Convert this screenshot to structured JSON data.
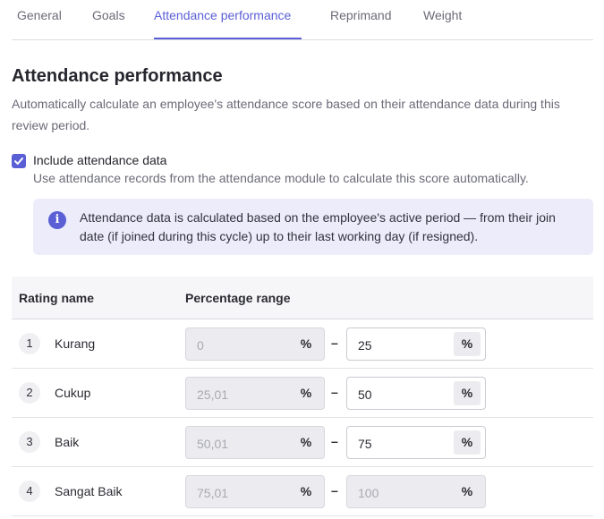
{
  "tabs": [
    {
      "label": "General",
      "active": false
    },
    {
      "label": "Goals",
      "active": false
    },
    {
      "label": "Attendance performance",
      "active": true
    },
    {
      "label": "Reprimand",
      "active": false
    },
    {
      "label": "Weight",
      "active": false
    }
  ],
  "section": {
    "title": "Attendance performance",
    "description": "Automatically calculate an employee's attendance score based on their attendance data during this review period."
  },
  "include_attendance": {
    "checked": true,
    "label": "Include attendance data",
    "help": "Use attendance records from the attendance module to calculate this score automatically."
  },
  "info": {
    "icon": "info-icon",
    "text": "Attendance data is calculated based on the employee's active period — from their join date (if joined during this cycle) up to their last working day (if resigned)."
  },
  "table": {
    "headers": {
      "rating_name": "Rating name",
      "percentage_range": "Percentage range"
    },
    "range_separator": "–",
    "unit": "%",
    "rows": [
      {
        "index": "1",
        "name": "Kurang",
        "from": "0",
        "to": "25",
        "to_editable": true
      },
      {
        "index": "2",
        "name": "Cukup",
        "from": "25,01",
        "to": "50",
        "to_editable": true
      },
      {
        "index": "3",
        "name": "Baik",
        "from": "50,01",
        "to": "75",
        "to_editable": true
      },
      {
        "index": "4",
        "name": "Sangat Baik",
        "from": "75,01",
        "to": "100",
        "to_editable": false
      }
    ]
  },
  "colors": {
    "accent": "#5a5fd6",
    "info_bg": "#ececfb",
    "disabled_bg": "#ececf0"
  }
}
